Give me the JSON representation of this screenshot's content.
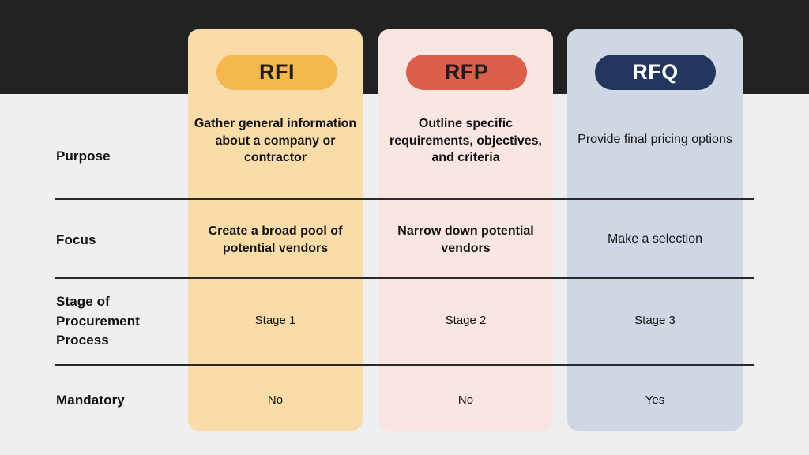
{
  "theme": {
    "band_color": "#222222",
    "page_background": "#EFEFF1",
    "divider_color": "#2A2A2A",
    "text_color": "#111111"
  },
  "columns": [
    {
      "key": "rfi",
      "label": "RFI",
      "card_color": "#FADCA8",
      "pill_color": "#F5B84F",
      "pill_text_color": "#1E1E1E"
    },
    {
      "key": "rfp",
      "label": "RFP",
      "card_color": "#F9E5E1",
      "pill_color": "#DB604B",
      "pill_text_color": "#1E1E1E"
    },
    {
      "key": "rfq",
      "label": "RFQ",
      "card_color": "#D0D7E4",
      "pill_color": "#22365F",
      "pill_text_color": "#FFFFFF"
    }
  ],
  "rows": [
    {
      "key": "purpose",
      "label": "Purpose",
      "rfi": "Gather general information about a company or contractor",
      "rfp": "Outline specific requirements, objectives, and criteria",
      "rfq": "Provide final pricing options"
    },
    {
      "key": "focus",
      "label": "Focus",
      "rfi": "Create a broad pool of potential vendors",
      "rfp": "Narrow down potential vendors",
      "rfq": "Make a selection"
    },
    {
      "key": "stage",
      "label": "Stage of Procurement Process",
      "rfi": "Stage 1",
      "rfp": "Stage 2",
      "rfq": "Stage 3"
    },
    {
      "key": "mandatory",
      "label": "Mandatory",
      "rfi": "No",
      "rfp": "No",
      "rfq": "Yes"
    }
  ]
}
